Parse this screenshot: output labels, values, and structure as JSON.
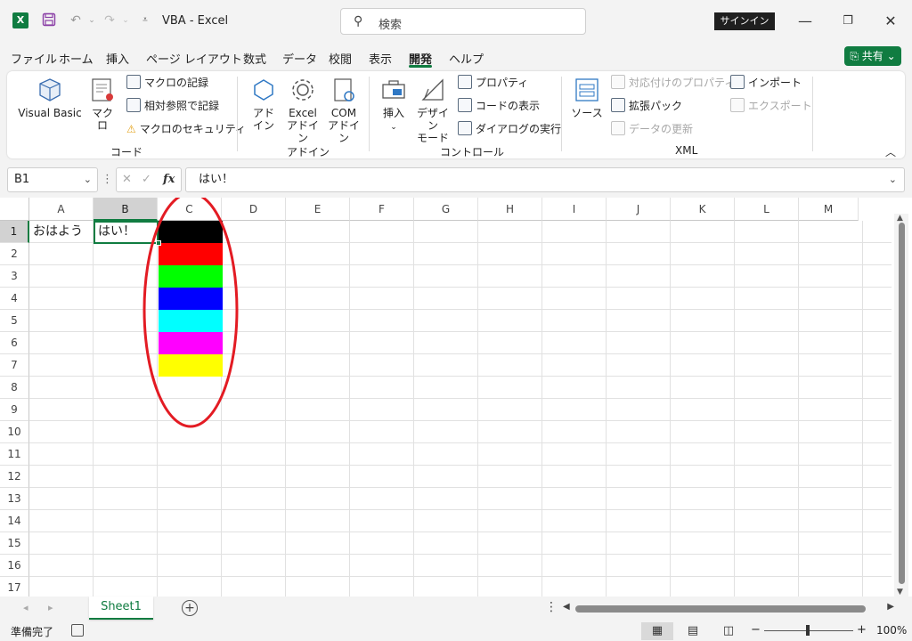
{
  "titlebar": {
    "doc_title": "VBA  -  Excel",
    "search_placeholder": "検索",
    "signin": "サインイン",
    "excel_logo": "X"
  },
  "menu": {
    "tabs": [
      "ファイル",
      "ホーム",
      "挿入",
      "ページ レイアウト",
      "数式",
      "データ",
      "校閲",
      "表示",
      "開発",
      "ヘルプ"
    ],
    "active_tab": "開発",
    "share": "共有"
  },
  "ribbon": {
    "code": {
      "group": "コード",
      "visual_basic": "Visual Basic",
      "macro": "マクロ",
      "record_macro": "マクロの記録",
      "relative_ref": "相対参照で記録",
      "macro_security": "マクロのセキュリティ"
    },
    "addins": {
      "group": "アドイン",
      "addin_line1": "アド",
      "addin_line2": "イン",
      "excel_addin_line1": "Excel",
      "excel_addin_line2": "アドイン",
      "com_addin_line1": "COM",
      "com_addin_line2": "アドイン"
    },
    "controls": {
      "group": "コントロール",
      "insert": "挿入",
      "design_line1": "デザイン",
      "design_line2": "モード",
      "properties": "プロパティ",
      "view_code": "コードの表示",
      "run_dialog": "ダイアログの実行"
    },
    "xml": {
      "group": "XML",
      "source": "ソース",
      "map_properties": "対応付けのプロパティ",
      "expansion_packs": "拡張パック",
      "refresh_data": "データの更新",
      "import": "インポート",
      "export": "エクスポート"
    }
  },
  "formula_bar": {
    "name_box": "B1",
    "formula": "はい！",
    "fx": "fx"
  },
  "grid": {
    "columns": [
      "A",
      "B",
      "C",
      "D",
      "E",
      "F",
      "G",
      "H",
      "I",
      "J",
      "K",
      "L",
      "M"
    ],
    "rows": [
      "1",
      "2",
      "3",
      "4",
      "5",
      "6",
      "7",
      "8",
      "9",
      "10",
      "11",
      "12",
      "13",
      "14",
      "15",
      "16",
      "17"
    ],
    "selected_cell": "B1",
    "cells": {
      "A1": "おはよう",
      "B1": "はい！"
    },
    "c_column_fill_colors": [
      "#000000",
      "#ff0000",
      "#00ff00",
      "#0000ff",
      "#00ffff",
      "#ff00ff",
      "#ffff00"
    ],
    "annotation_color": "#e31b23"
  },
  "sheets": {
    "tabs": [
      "Sheet1"
    ],
    "active": "Sheet1"
  },
  "status": {
    "ready": "準備完了",
    "zoom": "100%"
  },
  "colors": {
    "accent": "#107c41"
  }
}
